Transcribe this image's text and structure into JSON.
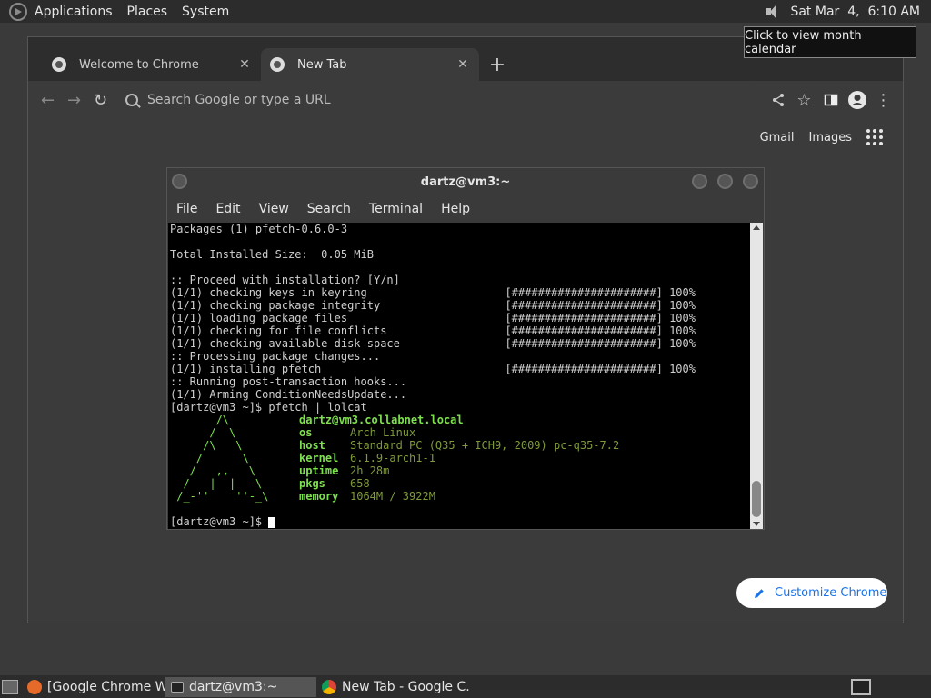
{
  "top_panel": {
    "menus": [
      "Applications",
      "Places",
      "System"
    ],
    "clock": "Sat Mar  4,  6:10 AM"
  },
  "tooltip": "Click to view month calendar",
  "chrome": {
    "tabs": [
      {
        "title": "Welcome to Chrome",
        "close": "✕"
      },
      {
        "title": "New Tab",
        "close": "✕"
      }
    ],
    "new_tab": "+",
    "omnibox_placeholder": "Search Google or type a URL",
    "links": {
      "gmail": "Gmail",
      "images": "Images"
    },
    "customize": "Customize Chrome",
    "icons": {
      "back": "←",
      "forward": "→",
      "reload": "↻",
      "share": "share-icon",
      "star": "☆",
      "sidebar": "▮",
      "menu": "⋮"
    }
  },
  "terminal": {
    "title": "dartz@vm3:~",
    "menu": [
      "File",
      "Edit",
      "View",
      "Search",
      "Terminal",
      "Help"
    ],
    "lines": [
      "Packages (1) pfetch-0.6.0-3",
      "",
      "Total Installed Size:  0.05 MiB",
      "",
      ":: Proceed with installation? [Y/n]",
      "(1/1) checking keys in keyring                     [######################] 100%",
      "(1/1) checking package integrity                   [######################] 100%",
      "(1/1) loading package files                        [######################] 100%",
      "(1/1) checking for file conflicts                  [######################] 100%",
      "(1/1) checking available disk space                [######################] 100%",
      ":: Processing package changes...",
      "(1/1) installing pfetch                            [######################] 100%",
      ":: Running post-transaction hooks...",
      "(1/1) Arming ConditionNeedsUpdate...",
      "[dartz@vm3 ~]$ pfetch | lolcat"
    ],
    "pfetch": {
      "art": [
        "       /\\",
        "      /  \\",
        "     /\\   \\",
        "    /      \\",
        "   /   ,,   \\",
        "  /   |  |  -\\",
        " /_-''    ''-_\\"
      ],
      "rows": [
        {
          "key": "dartz@vm3.collabnet.local",
          "val": ""
        },
        {
          "key": "os",
          "val": "Arch Linux"
        },
        {
          "key": "host",
          "val": "Standard PC (Q35 + ICH9, 2009) pc-q35-7.2"
        },
        {
          "key": "kernel",
          "val": "6.1.9-arch1-1"
        },
        {
          "key": "uptime",
          "val": "2h 28m"
        },
        {
          "key": "pkgs",
          "val": "658"
        },
        {
          "key": "memory",
          "val": "1064M / 3922M"
        }
      ]
    },
    "prompt": "[dartz@vm3 ~]$ "
  },
  "taskbar": {
    "items": [
      {
        "label": "[Google Chrome W...",
        "active": false
      },
      {
        "label": "dartz@vm3:~",
        "active": true
      },
      {
        "label": "New Tab - Google C...",
        "active": false
      }
    ]
  }
}
